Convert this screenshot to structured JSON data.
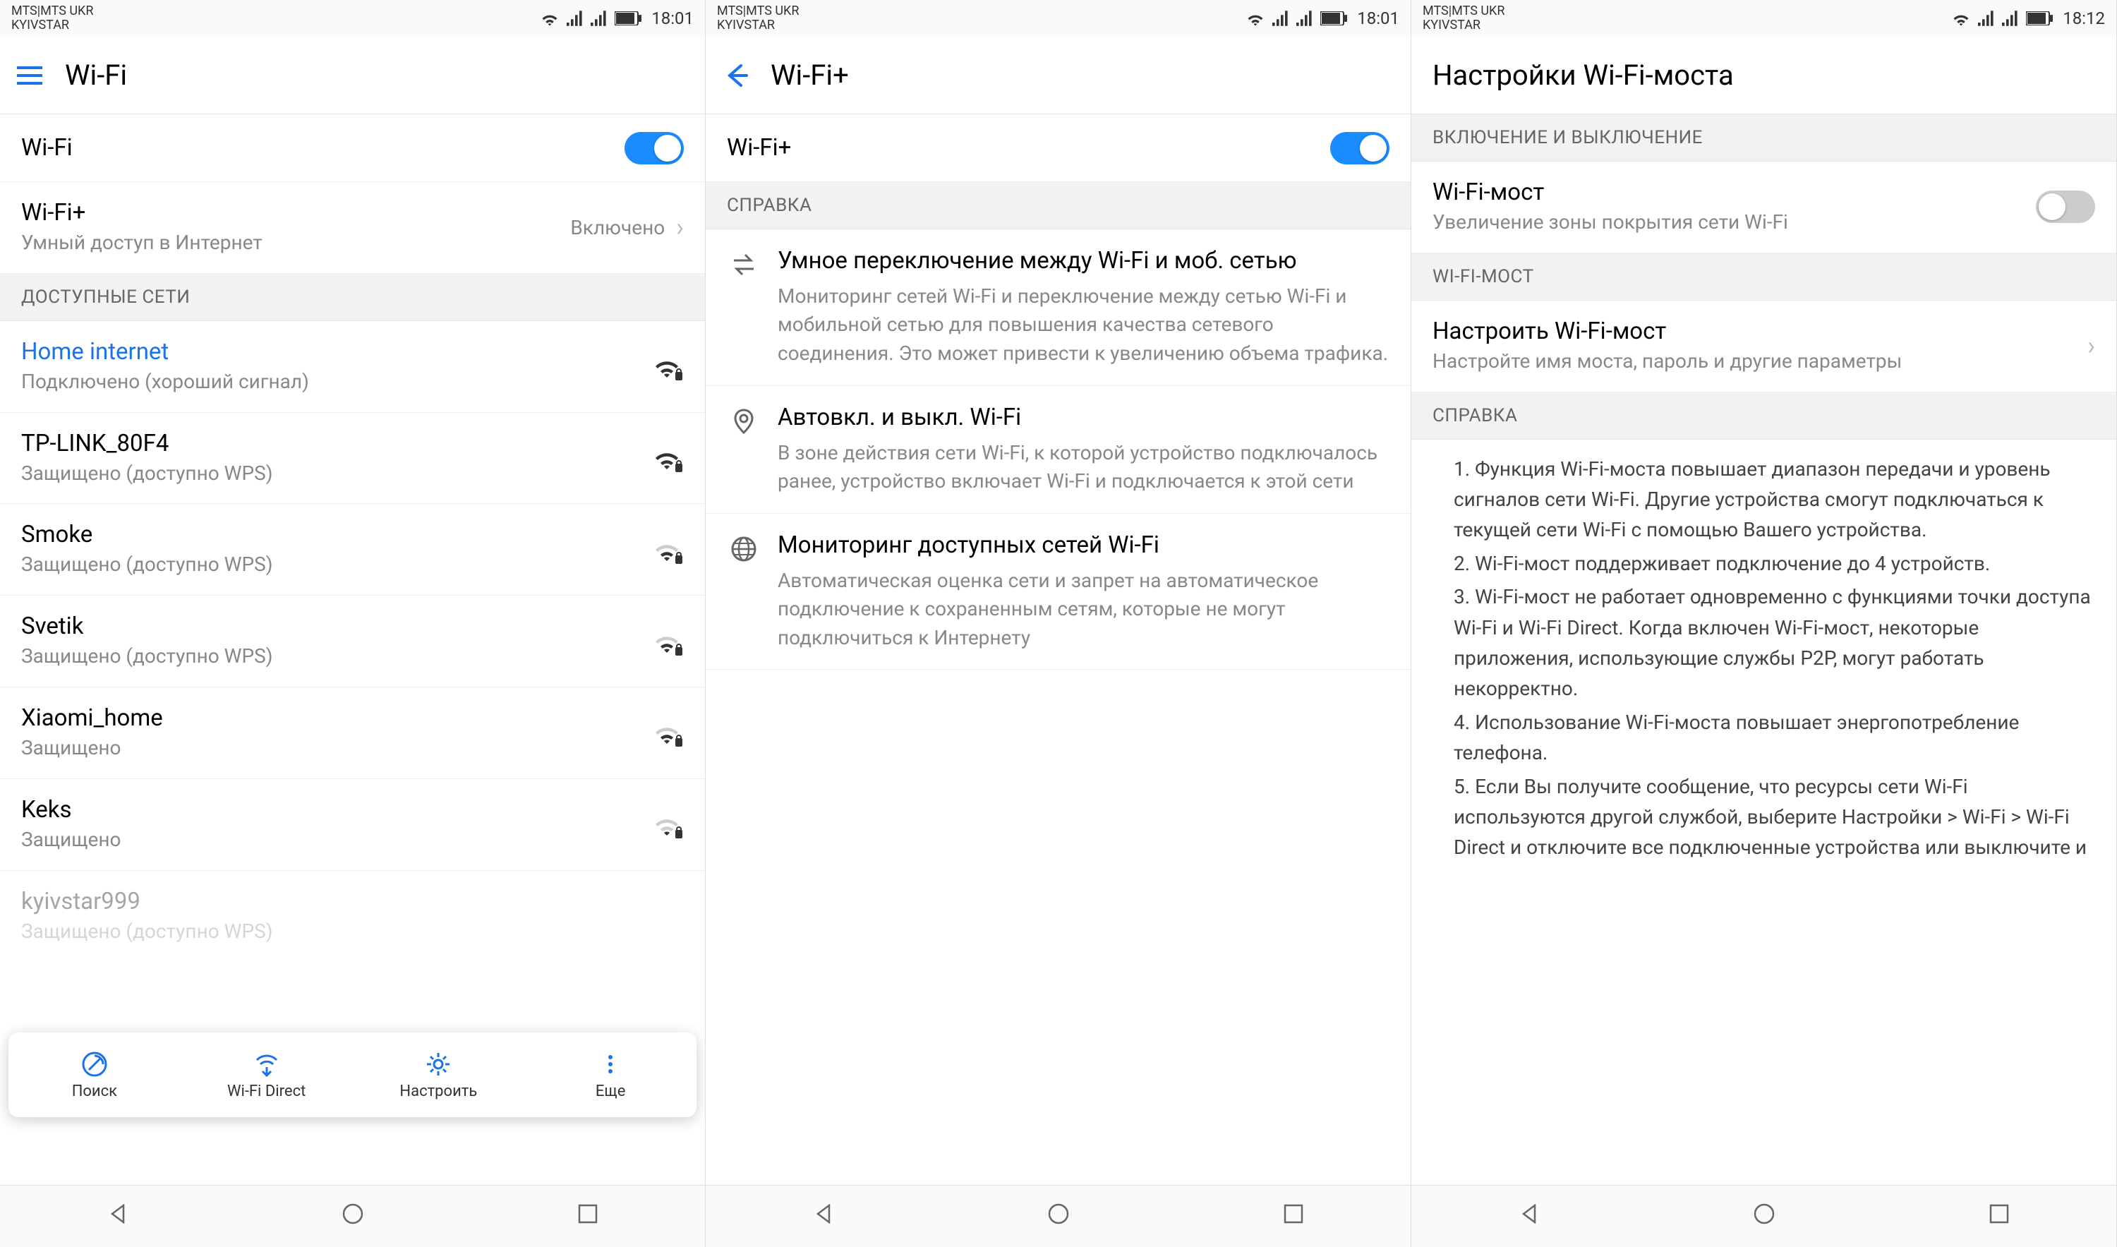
{
  "status": {
    "carrier1": "MTS|MTS UKR",
    "carrier2": "KYIVSTAR",
    "time_a": "18:01",
    "time_c": "18:12"
  },
  "s1": {
    "title": "Wi-Fi",
    "wifi_label": "Wi-Fi",
    "wifi_plus_title": "Wi-Fi+",
    "wifi_plus_status": "Включено",
    "wifi_plus_sub": "Умный доступ в Интернет",
    "section_networks": "ДОСТУПНЫЕ СЕТИ",
    "networks": [
      {
        "name": "Home internet",
        "sub": "Подключено (хороший сигнал)",
        "active": true
      },
      {
        "name": "TP-LINK_80F4",
        "sub": "Защищено (доступно WPS)"
      },
      {
        "name": "Smoke",
        "sub": "Защищено (доступно WPS)"
      },
      {
        "name": "Svetik",
        "sub": "Защищено (доступно WPS)"
      },
      {
        "name": "Xiaomi_home",
        "sub": "Защищено"
      },
      {
        "name": "Keks",
        "sub": "Защищено"
      },
      {
        "name": "kyivstar999",
        "sub": "Защищено (доступно WPS)"
      }
    ],
    "actions": {
      "search": "Поиск",
      "wifi_direct": "Wi-Fi Direct",
      "configure": "Настроить",
      "more": "Еще"
    }
  },
  "s2": {
    "title": "Wi-Fi+",
    "wifi_plus_label": "Wi-Fi+",
    "section_help": "СПРАВКА",
    "help": [
      {
        "title": "Умное переключение между Wi-Fi и моб. сетью",
        "desc": "Мониторинг сетей Wi-Fi и переключение между сетью Wi-Fi и мобильной сетью для повышения качества сетевого соединения. Это может привести к увеличению объема трафика."
      },
      {
        "title": "Автовкл. и выкл. Wi-Fi",
        "desc": "В зоне действия сети Wi-Fi, к которой устройство подключалось ранее, устройство включает Wi-Fi и подключается к этой сети"
      },
      {
        "title": "Мониторинг доступных сетей Wi-Fi",
        "desc": "Автоматическая оценка сети и запрет на автоматическое подключение к сохраненным сетям, которые не могут подключиться к Интернету"
      }
    ]
  },
  "s3": {
    "title": "Настройки Wi-Fi-моста",
    "section_onoff": "ВКЛЮЧЕНИЕ И ВЫКЛЮЧЕНИЕ",
    "bridge_title": "Wi-Fi-мост",
    "bridge_sub": "Увеличение зоны покрытия сети Wi-Fi",
    "section_bridge": "WI-FI-МОСТ",
    "configure_title": "Настроить Wi-Fi-мост",
    "configure_sub": "Настройте имя моста, пароль и другие параметры",
    "section_help": "СПРАВКА",
    "help_items": [
      "1. Функция Wi-Fi-моста повышает диапазон передачи и уровень сигналов сети Wi-Fi. Другие устройства смогут подключаться к текущей сети Wi-Fi с помощью Вашего устройства.",
      "2. Wi-Fi-мост поддерживает подключение до 4 устройств.",
      "3. Wi-Fi-мост не работает одновременно с функциями точки доступа Wi-Fi и Wi-Fi Direct. Когда включен Wi-Fi-мост, некоторые приложения, использующие службы Р2Р, могут работать некорректно.",
      "4. Использование Wi-Fi-моста повышает энергопотребление телефона.",
      "5. Если Вы получите сообщение, что ресурсы сети Wi-Fi используются другой службой, выберите Настройки > Wi-Fi > Wi-Fi Direct и отключите все подключенные устройства или выключите и"
    ]
  }
}
